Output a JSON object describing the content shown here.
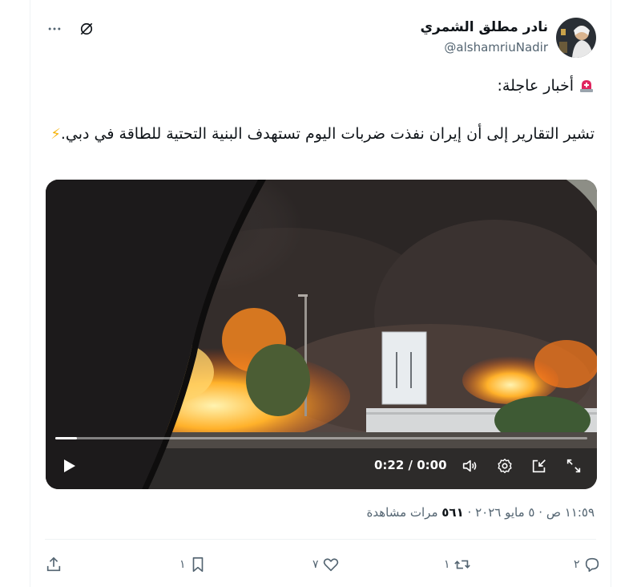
{
  "author": {
    "name": "نادر مطلق الشمري",
    "handle": "@alshamriuNadir"
  },
  "header_icons": [
    "grok-icon",
    "more-icon"
  ],
  "tweet": {
    "line1": "أخبار عاجلة:",
    "line2": "تشير التقارير إلى أن إيران نفذت ضربات اليوم تستهدف البنية التحتية للطاقة في دبي.",
    "emoji_siren": "🚨",
    "emoji_bolt": "⚡"
  },
  "video": {
    "time": "0:22 / 0:00",
    "progress": 0.04
  },
  "meta": {
    "time": "١١:٥٩ ص",
    "date": "٥ مايو ٢٠٢٦",
    "views_count": "٥٦١",
    "views_label": "مرات مشاهدة",
    "separator": "·"
  },
  "actions": {
    "reply_count": "٢",
    "retweet_count": "١",
    "like_count": "٧",
    "bookmark_count": "١"
  }
}
